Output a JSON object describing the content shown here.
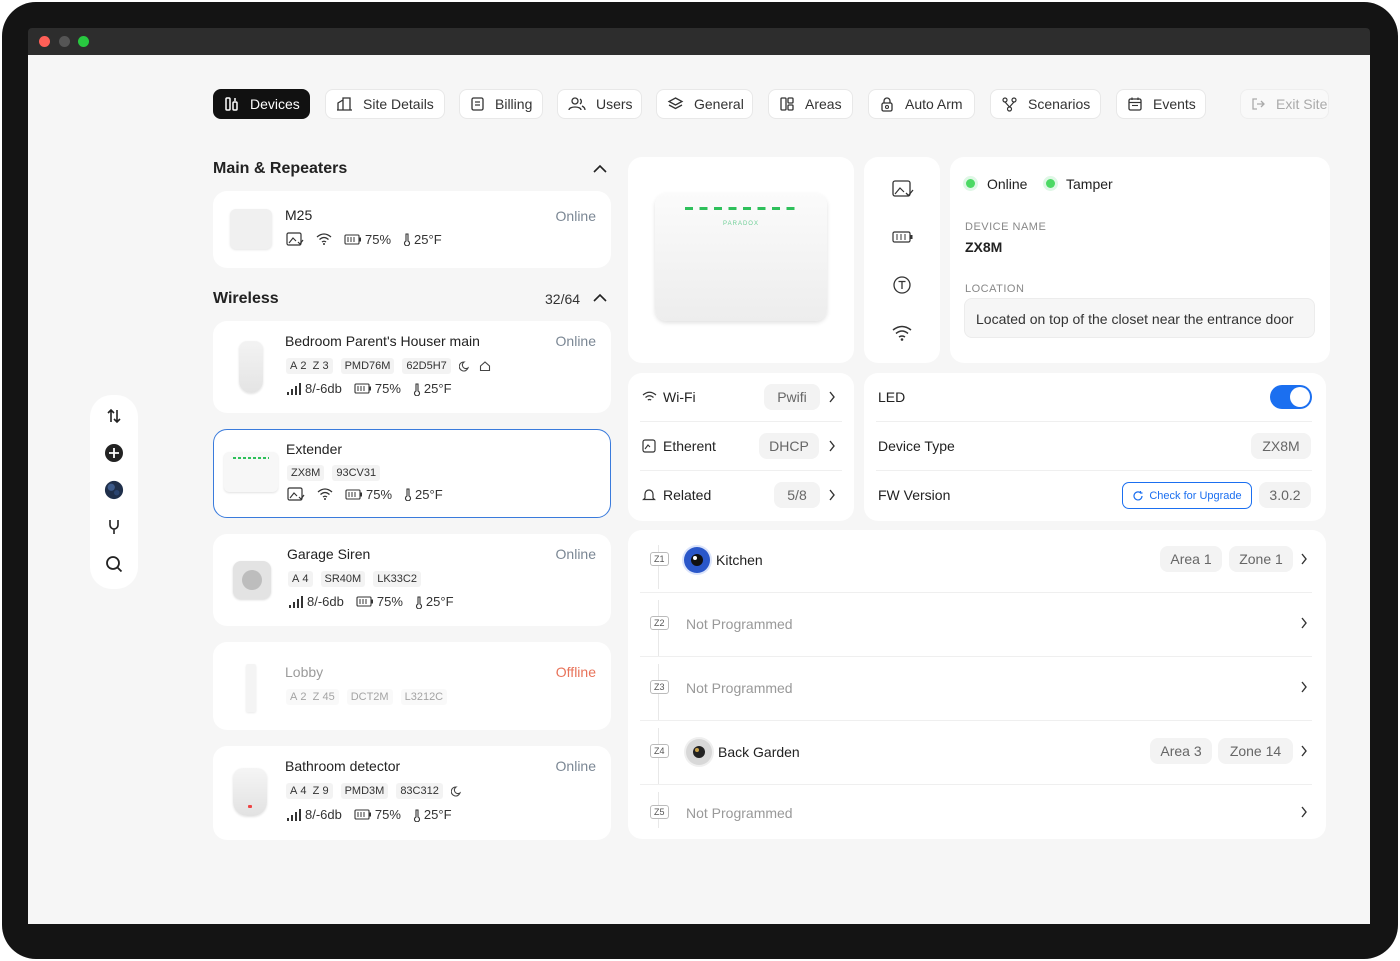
{
  "nav": {
    "devices": "Devices",
    "site_details": "Site Details",
    "billing": "Billing",
    "users": "Users",
    "general": "General",
    "areas": "Areas",
    "auto_arm": "Auto Arm",
    "scenarios": "Scenarios",
    "events": "Events",
    "exit_site": "Exit Site"
  },
  "main_section": {
    "title": "Main & Repeaters"
  },
  "main_device": {
    "name": "M25",
    "status": "Online",
    "battery": "75%",
    "temp": "25°F"
  },
  "wireless_section": {
    "title": "Wireless",
    "count": "32/64"
  },
  "wireless_devices": [
    {
      "name": "Bedroom Parent's Houser main",
      "status": "Online",
      "tags": [
        "A",
        "2",
        "Z",
        "3",
        "PMD76M",
        "62D5H7"
      ],
      "signal": "8/-6db",
      "battery": "75%",
      "temp": "25°F"
    },
    {
      "name": "Extender",
      "status": "",
      "tags": [
        "ZX8M",
        "93CV31"
      ],
      "battery": "75%",
      "temp": "25°F"
    },
    {
      "name": "Garage Siren",
      "status": "Online",
      "tags": [
        "A",
        "4",
        "SR40M",
        "LK33C2"
      ],
      "signal": "8/-6db",
      "battery": "75%",
      "temp": "25°F"
    },
    {
      "name": "Lobby",
      "status": "Offline",
      "tags": [
        "A",
        "2",
        "Z",
        "45",
        "DCT2M",
        "L3212C"
      ]
    },
    {
      "name": "Bathroom detector",
      "status": "Online",
      "tags": [
        "A",
        "4",
        "Z",
        "9",
        "PMD3M",
        "83C312"
      ],
      "signal": "8/-6db",
      "battery": "75%",
      "temp": "25°F"
    }
  ],
  "device_detail": {
    "product_logo": "PARADOX",
    "status_online": "Online",
    "status_tamper": "Tamper",
    "device_name_label": "DEVICE NAME",
    "device_name": "ZX8M",
    "location_label": "LOCATION",
    "location": "Located on top of the closet near the entrance door"
  },
  "connectivity": {
    "wifi_label": "Wi-Fi",
    "wifi_value": "Pwifi",
    "ethernet_label": "Etherent",
    "ethernet_value": "DHCP",
    "related_label": "Related",
    "related_value": "5/8"
  },
  "settings": {
    "led_label": "LED",
    "led_on": true,
    "device_type_label": "Device Type",
    "device_type_value": "ZX8M",
    "fw_label": "FW Version",
    "upgrade_label": "Check for Upgrade",
    "fw_value": "3.0.2"
  },
  "zones": [
    {
      "badge": "Z1",
      "name": "Kitchen",
      "area": "Area 1",
      "zone": "Zone 1",
      "programmed": true
    },
    {
      "badge": "Z2",
      "name": "Not Programmed",
      "programmed": false
    },
    {
      "badge": "Z3",
      "name": "Not Programmed",
      "programmed": false
    },
    {
      "badge": "Z4",
      "name": "Back Garden",
      "area": "Area 3",
      "zone": "Zone 14",
      "programmed": true
    },
    {
      "badge": "Z5",
      "name": "Not Programmed",
      "programmed": false
    }
  ],
  "colors": {
    "accent": "#1b6ff0",
    "online_dot": "#4cd964",
    "offline": "#e8735a",
    "selected_border": "#3a7bdc"
  }
}
